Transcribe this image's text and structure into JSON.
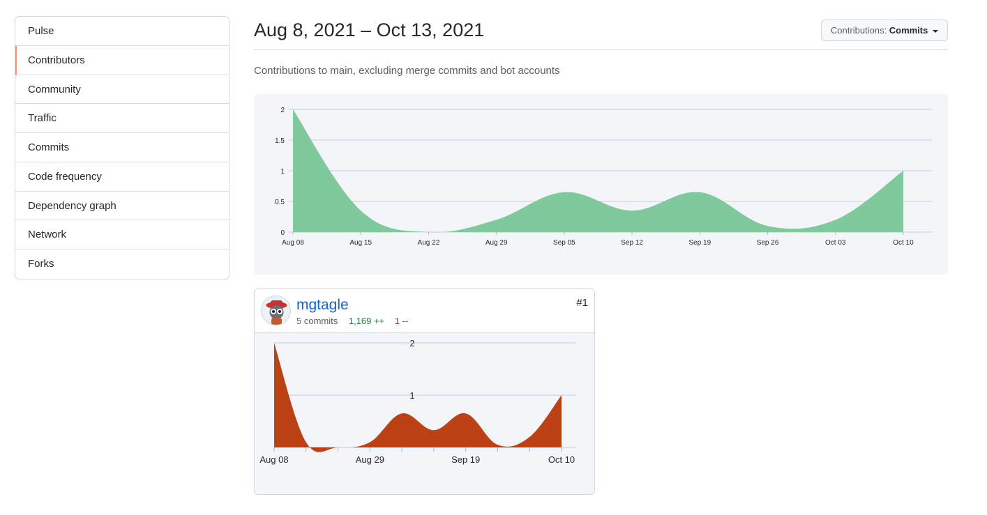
{
  "sidebar": {
    "items": [
      {
        "label": "Pulse"
      },
      {
        "label": "Contributors",
        "selected": true
      },
      {
        "label": "Community"
      },
      {
        "label": "Traffic"
      },
      {
        "label": "Commits"
      },
      {
        "label": "Code frequency"
      },
      {
        "label": "Dependency graph"
      },
      {
        "label": "Network"
      },
      {
        "label": "Forks"
      }
    ]
  },
  "header": {
    "range_title": "Aug 8, 2021 – Oct 13, 2021",
    "contrib_prefix": "Contributions:",
    "contrib_value": "Commits",
    "caret_icon": "caret-down-icon"
  },
  "subtitle": "Contributions to main, excluding merge commits and bot accounts",
  "chart_data": [
    {
      "type": "area",
      "title": "",
      "xlabel": "",
      "ylabel": "",
      "x": [
        "Aug 08",
        "Aug 15",
        "Aug 22",
        "Aug 29",
        "Sep 05",
        "Sep 12",
        "Sep 19",
        "Sep 26",
        "Oct 03",
        "Oct 10"
      ],
      "series": [
        {
          "values": [
            2,
            0.35,
            0,
            0.2,
            0.65,
            0.35,
            0.65,
            0.1,
            0.2,
            1
          ]
        }
      ],
      "y_ticks": [
        "0",
        "0.5",
        "1",
        "1.5",
        "2"
      ],
      "ylim": [
        0,
        2
      ],
      "grid": true,
      "color": "#7fc99c"
    },
    {
      "type": "area",
      "title": "",
      "xlabel": "",
      "ylabel": "",
      "x": [
        "Aug 08",
        "Aug 15",
        "Aug 22",
        "Aug 29",
        "Sep 05",
        "Sep 12",
        "Sep 19",
        "Sep 26",
        "Oct 03",
        "Oct 10"
      ],
      "x_tick_labels": [
        "Aug 08",
        "",
        "",
        "Aug 29",
        "",
        "",
        "Sep 19",
        "",
        "",
        "Oct 10"
      ],
      "series": [
        {
          "values": [
            2,
            0.1,
            0,
            0.1,
            0.65,
            0.33,
            0.65,
            0.05,
            0.2,
            1
          ]
        }
      ],
      "y_ticks": [
        "1",
        "2"
      ],
      "ylim": [
        0,
        2
      ],
      "grid": true,
      "color": "#bc4216"
    }
  ],
  "contributor": {
    "login": "mgtagle",
    "commits": "5 commits",
    "additions": "1,169 ++",
    "deletions": "1 --",
    "rank": "#1",
    "avatar_icon": "avatar-icon"
  }
}
